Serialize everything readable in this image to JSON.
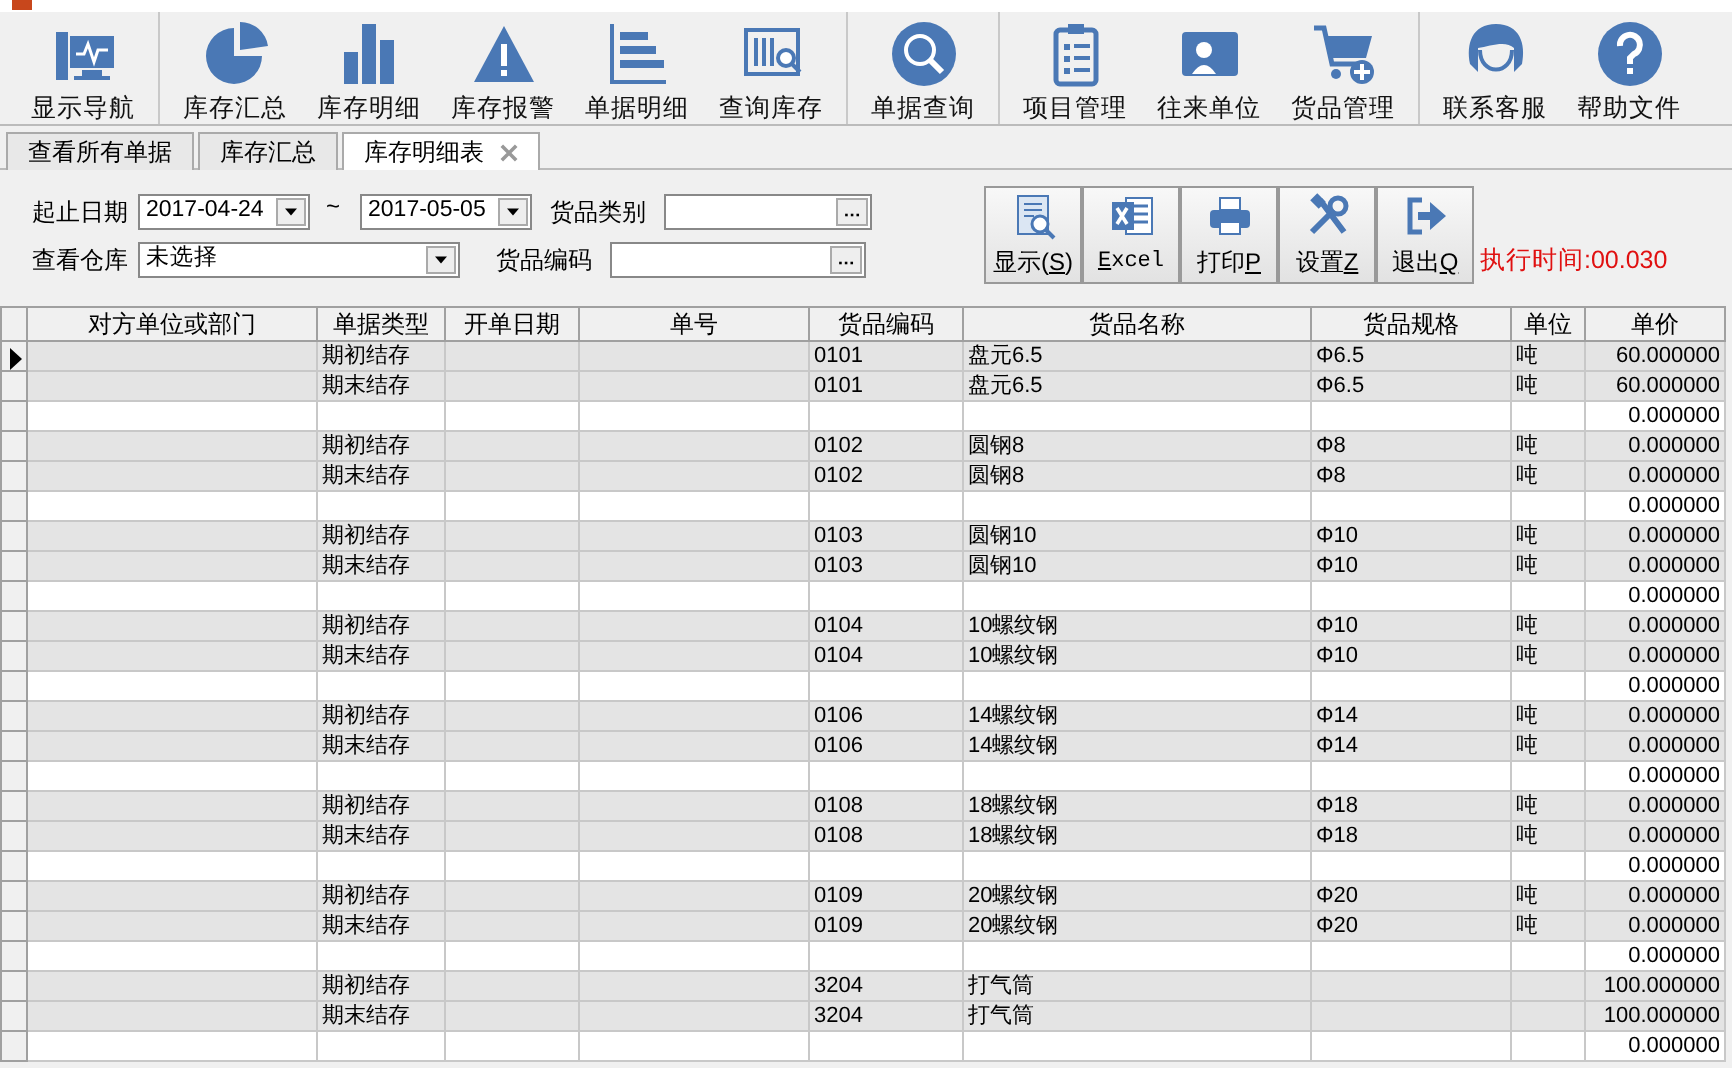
{
  "toolbar": {
    "groups": [
      [
        {
          "label": "显示导航"
        }
      ],
      [
        {
          "label": "库存汇总"
        },
        {
          "label": "库存明细"
        },
        {
          "label": "库存报警"
        },
        {
          "label": "单据明细"
        },
        {
          "label": "查询库存"
        }
      ],
      [
        {
          "label": "单据查询"
        }
      ],
      [
        {
          "label": "项目管理"
        },
        {
          "label": "往来单位"
        },
        {
          "label": "货品管理"
        }
      ],
      [
        {
          "label": "联系客服"
        },
        {
          "label": "帮助文件"
        }
      ]
    ]
  },
  "tabs": [
    {
      "label": "查看所有单据",
      "selected": false,
      "closable": false
    },
    {
      "label": "库存汇总",
      "selected": false,
      "closable": false
    },
    {
      "label": "库存明细表",
      "selected": true,
      "closable": true
    }
  ],
  "filters": {
    "date_label": "起止日期",
    "date_from": "2017-04-24",
    "date_separator": "~",
    "date_to": "2017-05-05",
    "category_label": "货品类别",
    "warehouse_label": "查看仓库",
    "warehouse": "未选择",
    "code_label": "货品编码"
  },
  "actions": [
    {
      "before": "显示(",
      "hotkey": "S",
      "after": ")"
    },
    {
      "hotkey": "E",
      "after": "xcel"
    },
    {
      "before": "打印",
      "hotkey": "P"
    },
    {
      "before": "设置",
      "hotkey": "Z"
    },
    {
      "before": "退出",
      "hotkey": "Q"
    }
  ],
  "execution_time": "执行时间:00.030",
  "table": {
    "columns": [
      "对方单位或部门",
      "单据类型",
      "开单日期",
      "单号",
      "货品编码",
      "货品名称",
      "货品规格",
      "单位",
      "单价"
    ],
    "rows": [
      {
        "kind": "detail",
        "selected": true,
        "type": "期初结存",
        "code": "0101",
        "name": "盘元6.5",
        "spec": "Φ6.5",
        "unit": "吨",
        "price": "60.000000"
      },
      {
        "kind": "detail",
        "selected": false,
        "type": "期末结存",
        "code": "0101",
        "name": "盘元6.5",
        "spec": "Φ6.5",
        "unit": "吨",
        "price": "60.000000"
      },
      {
        "kind": "total",
        "selected": false,
        "price": "0.000000"
      },
      {
        "kind": "detail",
        "selected": false,
        "type": "期初结存",
        "code": "0102",
        "name": "圆钢8",
        "spec": "Φ8",
        "unit": "吨",
        "price": "0.000000"
      },
      {
        "kind": "detail",
        "selected": false,
        "type": "期末结存",
        "code": "0102",
        "name": "圆钢8",
        "spec": "Φ8",
        "unit": "吨",
        "price": "0.000000"
      },
      {
        "kind": "total",
        "selected": false,
        "price": "0.000000"
      },
      {
        "kind": "detail",
        "selected": false,
        "type": "期初结存",
        "code": "0103",
        "name": "圆钢10",
        "spec": "Φ10",
        "unit": "吨",
        "price": "0.000000"
      },
      {
        "kind": "detail",
        "selected": false,
        "type": "期末结存",
        "code": "0103",
        "name": "圆钢10",
        "spec": "Φ10",
        "unit": "吨",
        "price": "0.000000"
      },
      {
        "kind": "total",
        "selected": false,
        "price": "0.000000"
      },
      {
        "kind": "detail",
        "selected": false,
        "type": "期初结存",
        "code": "0104",
        "name": "10螺纹钢",
        "spec": "Φ10",
        "unit": "吨",
        "price": "0.000000"
      },
      {
        "kind": "detail",
        "selected": false,
        "type": "期末结存",
        "code": "0104",
        "name": "10螺纹钢",
        "spec": "Φ10",
        "unit": "吨",
        "price": "0.000000"
      },
      {
        "kind": "total",
        "selected": false,
        "price": "0.000000"
      },
      {
        "kind": "detail",
        "selected": false,
        "type": "期初结存",
        "code": "0106",
        "name": "14螺纹钢",
        "spec": "Φ14",
        "unit": "吨",
        "price": "0.000000"
      },
      {
        "kind": "detail",
        "selected": false,
        "type": "期末结存",
        "code": "0106",
        "name": "14螺纹钢",
        "spec": "Φ14",
        "unit": "吨",
        "price": "0.000000"
      },
      {
        "kind": "total",
        "selected": false,
        "price": "0.000000"
      },
      {
        "kind": "detail",
        "selected": false,
        "type": "期初结存",
        "code": "0108",
        "name": "18螺纹钢",
        "spec": "Φ18",
        "unit": "吨",
        "price": "0.000000"
      },
      {
        "kind": "detail",
        "selected": false,
        "type": "期末结存",
        "code": "0108",
        "name": "18螺纹钢",
        "spec": "Φ18",
        "unit": "吨",
        "price": "0.000000"
      },
      {
        "kind": "total",
        "selected": false,
        "price": "0.000000"
      },
      {
        "kind": "detail",
        "selected": false,
        "type": "期初结存",
        "code": "0109",
        "name": "20螺纹钢",
        "spec": "Φ20",
        "unit": "吨",
        "price": "0.000000"
      },
      {
        "kind": "detail",
        "selected": false,
        "type": "期末结存",
        "code": "0109",
        "name": "20螺纹钢",
        "spec": "Φ20",
        "unit": "吨",
        "price": "0.000000"
      },
      {
        "kind": "total",
        "selected": false,
        "price": "0.000000"
      },
      {
        "kind": "detail",
        "selected": false,
        "type": "期初结存",
        "code": "3204",
        "name": "打气筒",
        "price": "100.000000"
      },
      {
        "kind": "detail",
        "selected": false,
        "type": "期末结存",
        "code": "3204",
        "name": "打气筒",
        "price": "100.000000"
      },
      {
        "kind": "total",
        "selected": false,
        "price": "0.000000"
      }
    ]
  }
}
